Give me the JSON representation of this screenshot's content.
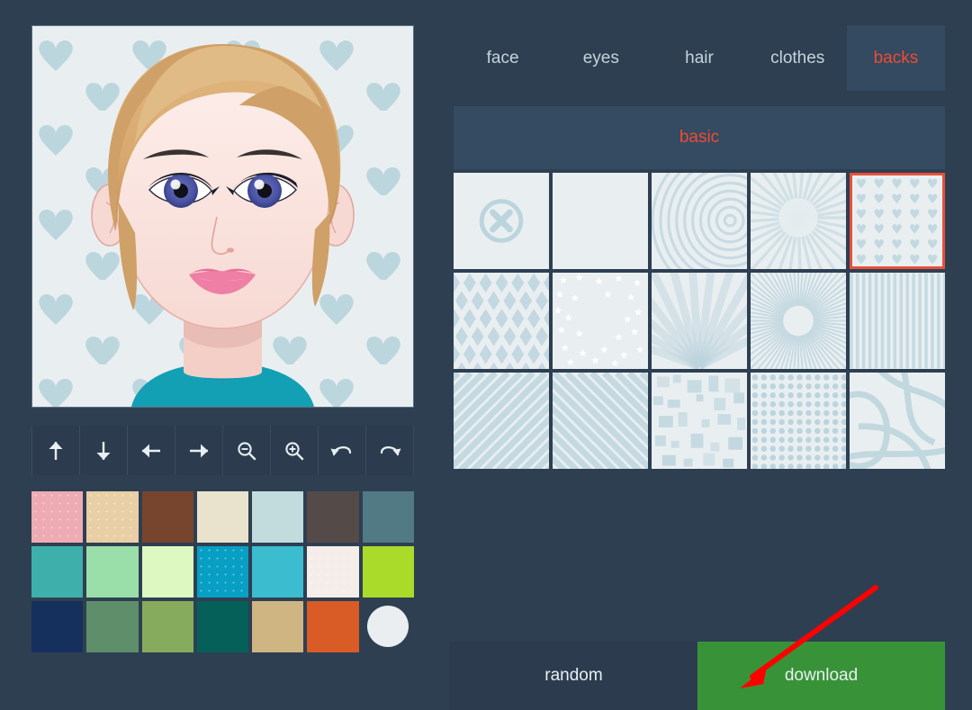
{
  "theme": {
    "page_bg": "#2e3f52",
    "panel_bg": "#2c3c4e",
    "active_tab_bg": "#334a60",
    "accent_red": "#ef4a32",
    "selected_border": "#e8503a",
    "download_green": "#389338",
    "swatch_bg": "#e9eff1",
    "pattern_blue": "#bcd4dd",
    "text_light": "#c7d3db"
  },
  "avatar": {
    "name": "avatar-preview",
    "hair_color": "#d8a971",
    "hair_shadow": "#c18f52",
    "skin_color": "#fbe6e2",
    "skin_shadow": "#f2ccc6",
    "eye_color": "#4b54a3",
    "lip_color": "#ef7fa4",
    "shirt_color": "#14a0b4",
    "background_pattern": "hearts",
    "background_color": "#e9eff1",
    "heart_color": "#bcd6de"
  },
  "toolbar": {
    "name": "transform-toolbar",
    "buttons": [
      {
        "name": "move-up-button",
        "icon": "arrow-up-icon",
        "label": "up"
      },
      {
        "name": "move-down-button",
        "icon": "arrow-down-icon",
        "label": "down"
      },
      {
        "name": "move-left-button",
        "icon": "arrow-left-icon",
        "label": "left"
      },
      {
        "name": "move-right-button",
        "icon": "arrow-right-icon",
        "label": "right"
      },
      {
        "name": "zoom-out-button",
        "icon": "magnifier-minus-icon",
        "label": "zoom out"
      },
      {
        "name": "zoom-in-button",
        "icon": "magnifier-plus-icon",
        "label": "zoom in"
      },
      {
        "name": "undo-button",
        "icon": "undo-arrow-icon",
        "label": "undo"
      },
      {
        "name": "redo-button",
        "icon": "redo-arrow-icon",
        "label": "redo"
      }
    ]
  },
  "palette": {
    "name": "color-palette",
    "rows": 3,
    "columns": 7,
    "colors": [
      {
        "name": "color-pink",
        "hex": "#efabb4",
        "textured": true
      },
      {
        "name": "color-tan",
        "hex": "#e9cfa5",
        "textured": true
      },
      {
        "name": "color-brown",
        "hex": "#77452e",
        "textured": false
      },
      {
        "name": "color-cream",
        "hex": "#e9e2cc",
        "textured": false
      },
      {
        "name": "color-pale-blue",
        "hex": "#c2dcdd",
        "textured": false
      },
      {
        "name": "color-dark-gray",
        "hex": "#544a48",
        "textured": false
      },
      {
        "name": "color-slate-blue",
        "hex": "#527a85",
        "textured": false
      },
      {
        "name": "color-teal",
        "hex": "#3fafab",
        "textured": false
      },
      {
        "name": "color-mint",
        "hex": "#9adeaa",
        "textured": false
      },
      {
        "name": "color-light-lime",
        "hex": "#ddf8c1",
        "textured": false
      },
      {
        "name": "color-cerulean",
        "hex": "#089fc4",
        "textured": true
      },
      {
        "name": "color-cyan",
        "hex": "#3cbccf",
        "textured": false
      },
      {
        "name": "color-off-white",
        "hex": "#f5ede9",
        "textured": true
      },
      {
        "name": "color-lime",
        "hex": "#aada2a",
        "textured": false
      },
      {
        "name": "color-navy",
        "hex": "#16305e",
        "textured": false
      },
      {
        "name": "color-sage-green",
        "hex": "#5f8e6b",
        "textured": false
      },
      {
        "name": "color-olive-green",
        "hex": "#87ab5c",
        "textured": false
      },
      {
        "name": "color-deep-teal",
        "hex": "#046059",
        "textured": false
      },
      {
        "name": "color-khaki",
        "hex": "#ceb582",
        "textured": false
      },
      {
        "name": "color-orange",
        "hex": "#d95b25",
        "textured": false
      },
      {
        "name": "color-white-selected",
        "hex": "#eaeef0",
        "textured": false,
        "shape": "circle"
      }
    ]
  },
  "tabs": {
    "name": "category-tabs",
    "active": "backs",
    "items": [
      {
        "name": "tab-face",
        "label": "face"
      },
      {
        "name": "tab-eyes",
        "label": "eyes"
      },
      {
        "name": "tab-hair",
        "label": "hair"
      },
      {
        "name": "tab-clothes",
        "label": "clothes"
      },
      {
        "name": "tab-backs",
        "label": "backs"
      }
    ]
  },
  "subtabs": {
    "name": "background-subtabs",
    "active": "basic",
    "items": [
      {
        "name": "subtab-basic",
        "label": "basic"
      }
    ]
  },
  "pattern_grid": {
    "name": "background-pattern-grid",
    "rows": 3,
    "columns": 5,
    "selected_index": 4,
    "items": [
      {
        "name": "pattern-none",
        "pattern": "none-x-circle"
      },
      {
        "name": "pattern-plain",
        "pattern": "plain"
      },
      {
        "name": "pattern-concentric",
        "pattern": "concentric-rings"
      },
      {
        "name": "pattern-sunburst-soft",
        "pattern": "sunburst-soft"
      },
      {
        "name": "pattern-hearts",
        "pattern": "hearts"
      },
      {
        "name": "pattern-diamonds",
        "pattern": "diamonds"
      },
      {
        "name": "pattern-stars",
        "pattern": "stars"
      },
      {
        "name": "pattern-rays-wide",
        "pattern": "rays-wide"
      },
      {
        "name": "pattern-radial-burst",
        "pattern": "radial-burst"
      },
      {
        "name": "pattern-vertical-stripes",
        "pattern": "vertical-stripes"
      },
      {
        "name": "pattern-diagonal-left",
        "pattern": "diagonal-left"
      },
      {
        "name": "pattern-diagonal-right",
        "pattern": "diagonal-right"
      },
      {
        "name": "pattern-squares",
        "pattern": "squares"
      },
      {
        "name": "pattern-dots",
        "pattern": "dots"
      },
      {
        "name": "pattern-curves",
        "pattern": "curves"
      }
    ]
  },
  "actions": {
    "name": "action-buttons",
    "random_label": "random",
    "download_label": "download"
  },
  "annotation": {
    "name": "arrow-annotation",
    "color": "#fe0000",
    "points_to": "download-button"
  }
}
